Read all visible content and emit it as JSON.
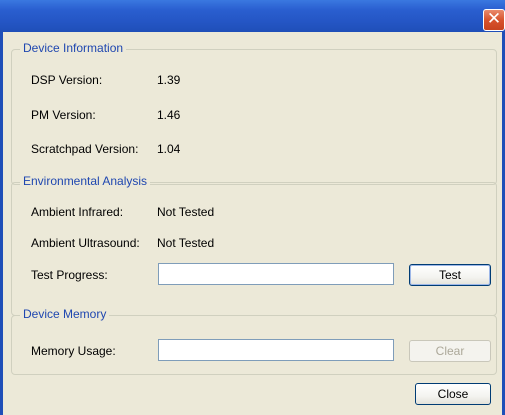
{
  "window": {
    "close_glyph": "✕"
  },
  "device_information": {
    "title": "Device Information",
    "rows": [
      {
        "label": "DSP Version:",
        "value": "1.39"
      },
      {
        "label": "PM Version:",
        "value": "1.46"
      },
      {
        "label": "Scratchpad Version:",
        "value": "1.04"
      }
    ]
  },
  "environmental_analysis": {
    "title": "Environmental Analysis",
    "ambient_infrared_label": "Ambient Infrared:",
    "ambient_infrared_value": "Not Tested",
    "ambient_ultrasound_label": "Ambient Ultrasound:",
    "ambient_ultrasound_value": "Not Tested",
    "test_progress_label": "Test Progress:",
    "test_progress_value": 0,
    "test_button_label": "Test"
  },
  "device_memory": {
    "title": "Device Memory",
    "memory_usage_label": "Memory Usage:",
    "memory_usage_value": 0,
    "clear_button_label": "Clear"
  },
  "footer": {
    "close_button_label": "Close"
  },
  "colors": {
    "title_bar": "#2455c4",
    "group_title": "#1f47b0",
    "dialog_face": "#ece9d8",
    "close_button_red": "#d8532d"
  }
}
